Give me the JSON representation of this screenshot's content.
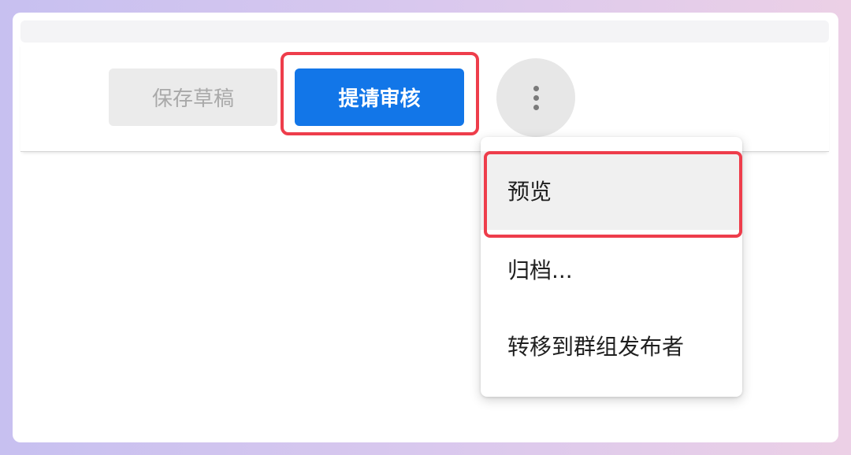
{
  "toolbar": {
    "save_draft_label": "保存草稿",
    "submit_review_label": "提请审核",
    "more_options_icon": "vertical-ellipsis-icon"
  },
  "menu": {
    "items": [
      {
        "label": "预览",
        "highlighted": true
      },
      {
        "label": "归档..."
      },
      {
        "label": "转移到群组发布者"
      }
    ]
  },
  "colors": {
    "primary": "#1276e8",
    "highlight_outline": "#ee3d4b",
    "disabled_bg": "#ebebeb",
    "disabled_text": "#a9a9a9"
  }
}
